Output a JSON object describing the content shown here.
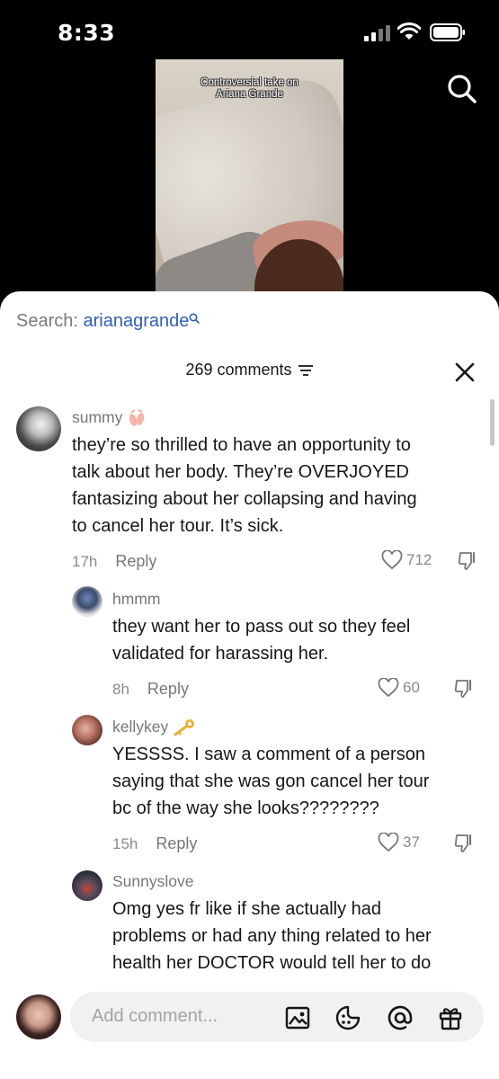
{
  "status_bar": {
    "time": "8:33"
  },
  "video": {
    "caption_line1": "Controversial take on",
    "caption_line2": "Ariana Grande"
  },
  "search": {
    "label": "Search:",
    "term": "arianagrande"
  },
  "comments_header": {
    "count_label": "269 comments"
  },
  "comments": [
    {
      "username": "summy",
      "text_lines": [
        "they’re so thrilled to have an opportunity to",
        "talk about her body. They’re OVERJOYED",
        "fantasizing about her collapsing and having",
        "to cancel her tour. It’s sick."
      ],
      "time": "17h",
      "reply_label": "Reply",
      "likes": "712"
    },
    {
      "username": "hmmm",
      "text_lines": [
        "they want her to pass out so they feel",
        "validated for harassing her."
      ],
      "time": "8h",
      "reply_label": "Reply",
      "likes": "60"
    },
    {
      "username": "kellykey",
      "text_lines": [
        "YESSSS. I saw a comment of a person",
        "saying that she was gon cancel her tour",
        "bc of the way she looks????????"
      ],
      "time": "15h",
      "reply_label": "Reply",
      "likes": "37"
    },
    {
      "username": "Sunnyslove",
      "text_lines": [
        "Omg yes fr like if she actually had",
        "problems or had any thing related to her",
        "health her DOCTOR would tell her to do"
      ],
      "time": "",
      "reply_label": "",
      "likes": ""
    }
  ],
  "composer": {
    "placeholder": "Add comment..."
  },
  "icons": [
    "search-icon",
    "filter-icon",
    "close-icon",
    "heart-icon",
    "dislike-icon",
    "image-icon",
    "emoji-icon",
    "mention-icon",
    "gift-icon"
  ],
  "colors": {
    "search_term": "#2d5fb8",
    "text": "#161616",
    "muted": "#8a8a8a"
  }
}
